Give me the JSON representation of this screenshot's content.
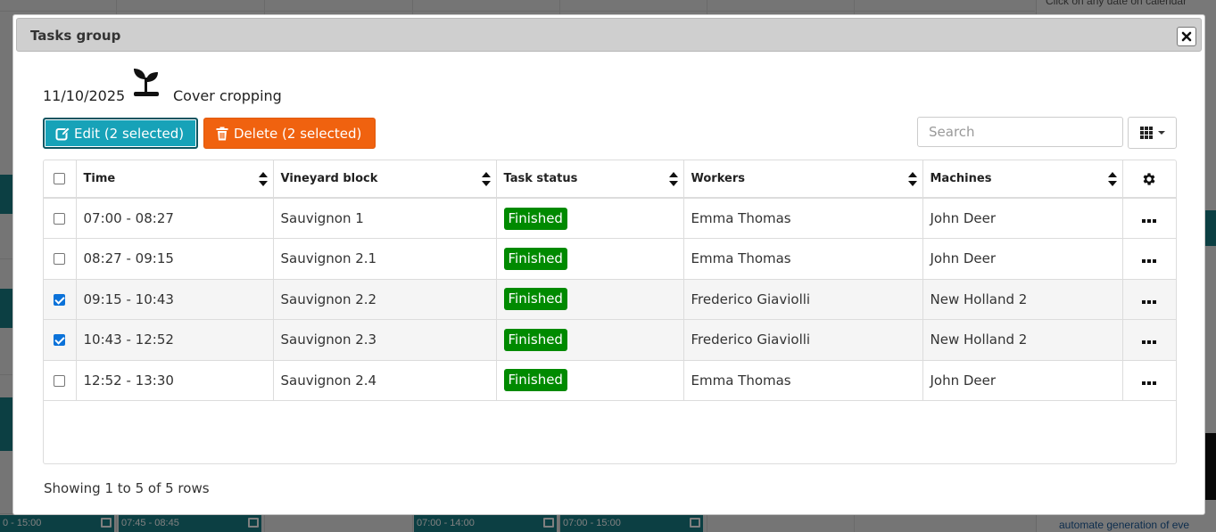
{
  "background": {
    "side_note": "Click on any date on calendar",
    "side_footer": "automate generation of eve",
    "events": [
      {
        "label": "0 - 15:00"
      },
      {
        "label": "07:45 - 08:45"
      },
      {
        "label": "07:00 - 14:00"
      },
      {
        "label": "07:00 - 15:00"
      }
    ]
  },
  "dialog": {
    "title": "Tasks group",
    "close_icon": "close-icon"
  },
  "task": {
    "date": "11/10/2025",
    "icon": "sprout-icon",
    "name": "Cover cropping"
  },
  "toolbar": {
    "edit_label": "Edit (2 selected)",
    "delete_label": "Delete (2 selected)",
    "search_placeholder": "Search",
    "columns_icon": "grid-icon"
  },
  "table": {
    "columns": {
      "time": "Time",
      "block": "Vineyard block",
      "status": "Task status",
      "workers": "Workers",
      "machines": "Machines"
    },
    "rows": [
      {
        "selected": false,
        "time": "07:00 - 08:27",
        "block": "Sauvignon 1",
        "status": "Finished",
        "workers": "Emma Thomas",
        "machines": "John Deer"
      },
      {
        "selected": false,
        "time": "08:27 - 09:15",
        "block": "Sauvignon 2.1",
        "status": "Finished",
        "workers": "Emma Thomas",
        "machines": "John Deer"
      },
      {
        "selected": true,
        "time": "09:15 - 10:43",
        "block": "Sauvignon 2.2",
        "status": "Finished",
        "workers": "Frederico Giaviolli",
        "machines": "New Holland 2"
      },
      {
        "selected": true,
        "time": "10:43 - 12:52",
        "block": "Sauvignon 2.3",
        "status": "Finished",
        "workers": "Frederico Giaviolli",
        "machines": "New Holland 2"
      },
      {
        "selected": false,
        "time": "12:52 - 13:30",
        "block": "Sauvignon 2.4",
        "status": "Finished",
        "workers": "Emma Thomas",
        "machines": "John Deer"
      }
    ]
  },
  "colors": {
    "edit_button": "#17a2b8",
    "delete_button": "#f0620f",
    "status_finished": "#008a00",
    "checkbox_checked": "#0b72d9"
  },
  "footer": {
    "pagination_text": "Showing 1 to 5 of 5 rows"
  }
}
